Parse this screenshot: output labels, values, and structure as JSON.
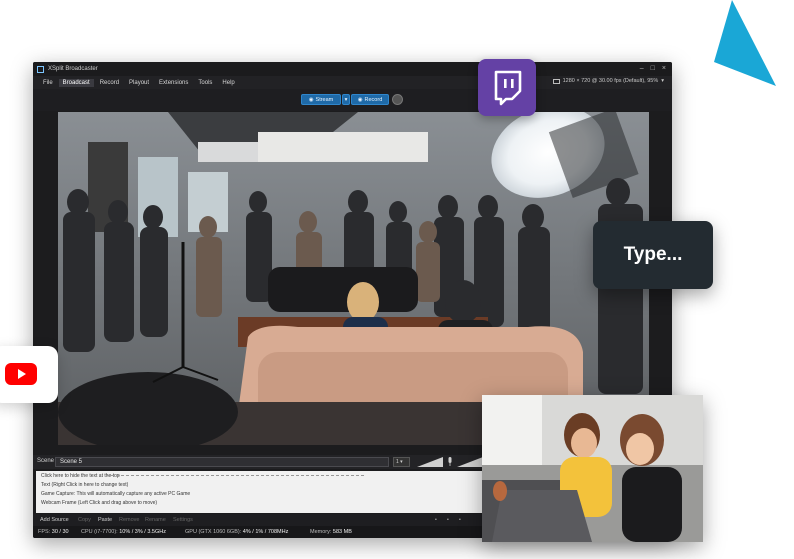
{
  "window": {
    "title": "XSplit Broadcaster",
    "controls": [
      "–",
      "□",
      "×"
    ]
  },
  "menu": {
    "items": [
      "File",
      "Broadcast",
      "Record",
      "Playout",
      "Extensions",
      "Tools",
      "Help"
    ],
    "active": "Broadcast",
    "resolution_info": "1280 × 720 @ 30.00 fps (Default), 95%"
  },
  "toolbar": {
    "stream_label": "Stream",
    "record_label": "Record"
  },
  "scene": {
    "label": "Scene",
    "current": "Scene 5",
    "number": "1"
  },
  "sources": {
    "lines": [
      "Click here to hide the text at the top",
      "Text (Right Click in here to change text)",
      "Game Capture: This will automatically capture any active PC Game",
      "Webcam Frame (Left Click and drag above to move)"
    ]
  },
  "actions": {
    "items": [
      "Add Source",
      "Copy",
      "Paste",
      "Remove",
      "Rename",
      "Settings"
    ],
    "disabled": [
      "Copy",
      "Remove",
      "Rename",
      "Settings"
    ]
  },
  "status": {
    "fps_label": "FPS:",
    "fps_value": "30 / 30",
    "cpu_label": "CPU (i7-7700):",
    "cpu_value": "10% / 3% / 3.5GHz",
    "gpu_label": "GPU (GTX 1060 6GB):",
    "gpu_value": "4% / 1% / 708MHz",
    "memory_label": "Memory:",
    "memory_value": "583 MB"
  },
  "overlay": {
    "type_card_text": "Type..."
  },
  "icons": {
    "twitch": "twitch-icon",
    "youtube": "youtube-icon",
    "camera": "camera-icon",
    "microphone": "microphone-icon"
  },
  "colors": {
    "twitch_purple": "#6441a5",
    "youtube_red": "#ff0000",
    "accent_cyan": "#1aa7d6",
    "toolbar_blue": "#1f6aa8",
    "type_card_bg": "#232b31"
  }
}
